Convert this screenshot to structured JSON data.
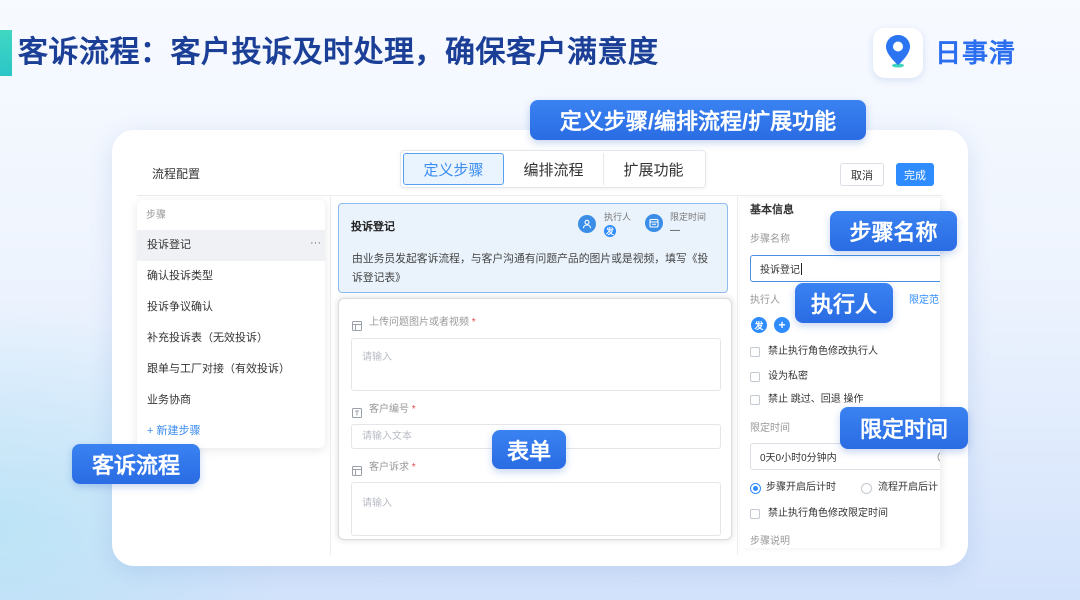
{
  "header": {
    "title": "客诉流程：客户投诉及时处理，确保客户满意度",
    "brand": "日事清",
    "logo_icon": "location-pin-icon"
  },
  "callouts": {
    "features": "定义步骤/编排流程/扩展功能",
    "flow": "客诉流程",
    "form": "表单",
    "step_name": "步骤名称",
    "executor": "执行人",
    "time_limit": "限定时间"
  },
  "app": {
    "title": "流程配置",
    "tabs": [
      {
        "label": "定义步骤",
        "active": true
      },
      {
        "label": "编排流程",
        "active": false
      },
      {
        "label": "扩展功能",
        "active": false
      }
    ],
    "actions": {
      "cancel": "取消",
      "done": "完成"
    },
    "steps_panel": {
      "header": "步骤",
      "items": [
        {
          "label": "投诉登记",
          "selected": true
        },
        {
          "label": "确认投诉类型",
          "selected": false
        },
        {
          "label": "投诉争议确认",
          "selected": false
        },
        {
          "label": "补充投诉表（无效投诉）",
          "selected": false
        },
        {
          "label": "跟单与工厂对接（有效投诉）",
          "selected": false
        },
        {
          "label": "业务协商",
          "selected": false
        }
      ],
      "more": "···",
      "add_icon": "+",
      "add_label": "新建步骤"
    },
    "step_card": {
      "title": "投诉登记",
      "executor_icon": "person-icon",
      "executor_label": "执行人",
      "executor_badge": "发",
      "time_icon": "calendar-icon",
      "time_label": "限定时间",
      "time_value": "—",
      "description": "由业务员发起客诉流程，与客户沟通有问题产品的图片或是视频，填写《投诉登记表》"
    },
    "form": {
      "fields": [
        {
          "icon": "form-field-icon",
          "label": "上传问题图片或者视频",
          "required": "*",
          "placeholder": "请输入"
        },
        {
          "icon": "text-field-icon",
          "label": "客户编号",
          "required": "*",
          "placeholder": "请输入文本"
        },
        {
          "icon": "form-field-icon",
          "label": "客户诉求",
          "required": "*",
          "placeholder": "请输入"
        }
      ]
    },
    "settings": {
      "section_title": "基本信息",
      "step_name_label": "步骤名称",
      "step_name_value": "投诉登记",
      "executor_label": "执行人",
      "executor_scope_link": "限定范",
      "executor_badge": "发",
      "add_executor_icon": "+",
      "options": [
        {
          "label": "禁止执行角色修改执行人",
          "checked": false
        },
        {
          "label": "设为私密",
          "checked": false
        },
        {
          "label": "禁止 跳过、回退 操作",
          "checked": false
        }
      ],
      "time_limit_label": "限定时间",
      "time_limit_value": "0天0小时0分钟内",
      "time_limit_icon": "clock-icon",
      "timer_modes": [
        {
          "label": "步骤开启后计时",
          "selected": true
        },
        {
          "label": "流程开启后计",
          "selected": false
        }
      ],
      "time_option": {
        "label": "禁止执行角色修改限定时间",
        "checked": false
      },
      "description_label": "步骤说明"
    }
  },
  "colors": {
    "accent": "#2a6ce3",
    "title": "#1b3f96",
    "brand": "#2b6ef0",
    "accent_bar": "#2cc6c8",
    "primary_button": "#2f8cff",
    "required": "#e5484d"
  }
}
